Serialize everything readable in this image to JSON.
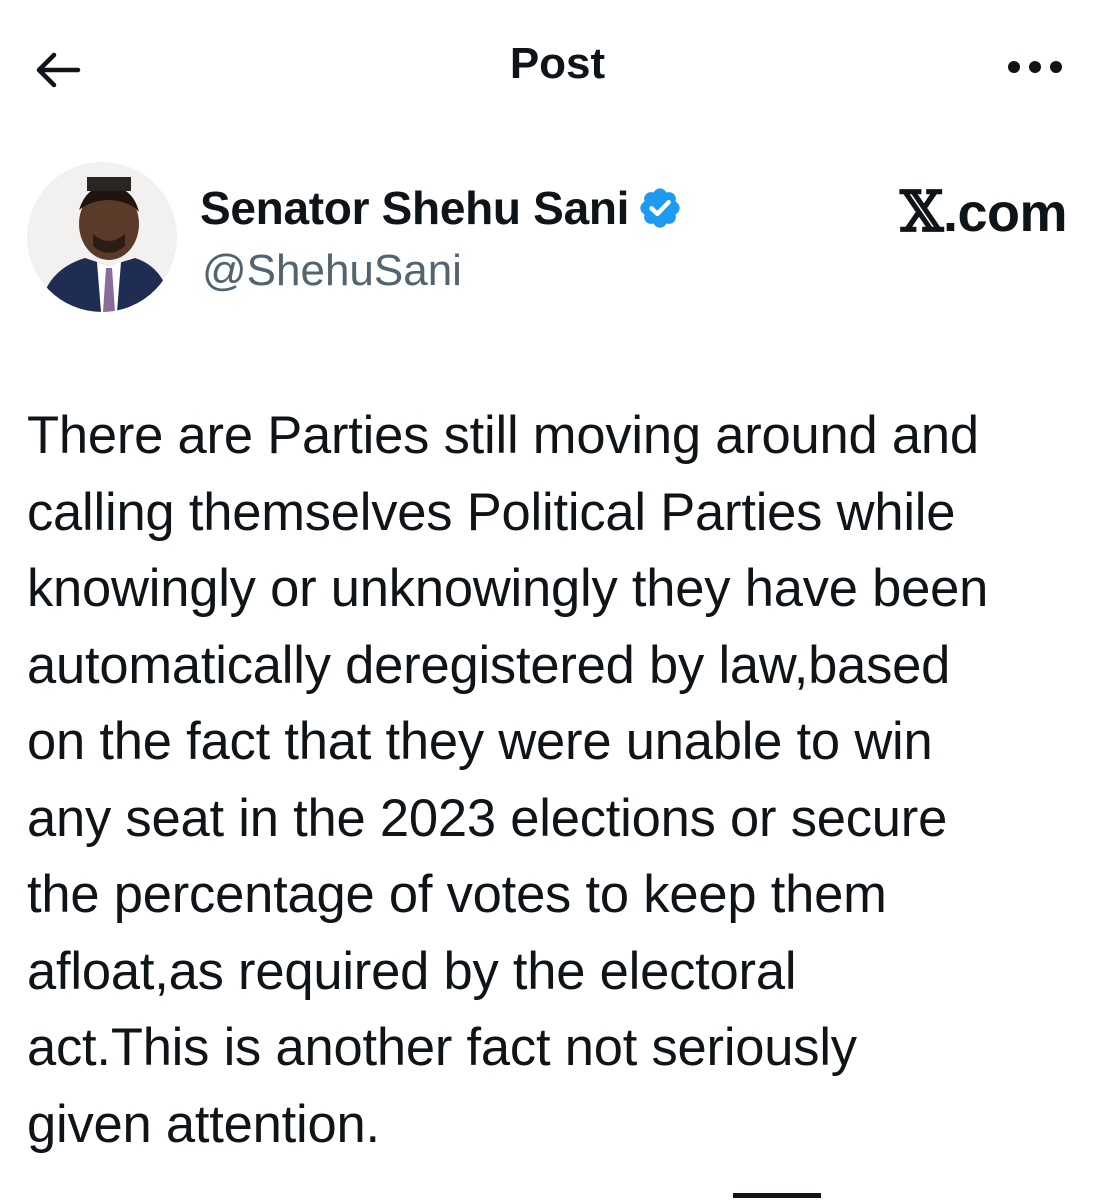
{
  "header": {
    "title": "Post",
    "back_icon": "arrow-left-icon",
    "more_icon": "more-horizontal-icon"
  },
  "author": {
    "display_name": "Senator Shehu Sani",
    "handle": "@ShehuSani",
    "verified_icon": "verified-badge-icon",
    "verified_color": "#1d9bf0"
  },
  "brand": {
    "text": ".com"
  },
  "tweet": {
    "text": "There are Parties still moving around and\ncalling themselves Political Parties while\nknowingly or unknowingly they have been\nautomatically deregistered by law,based\non the fact that they were unable to win\nany seat in the 2023 elections or secure\nthe percentage of votes to keep them\nafloat,as required by the electoral\nact.This is another fact not seriously\ngiven attention."
  },
  "colors": {
    "text_primary": "#0f1419",
    "text_secondary": "#536471",
    "accent": "#1d9bf0"
  }
}
